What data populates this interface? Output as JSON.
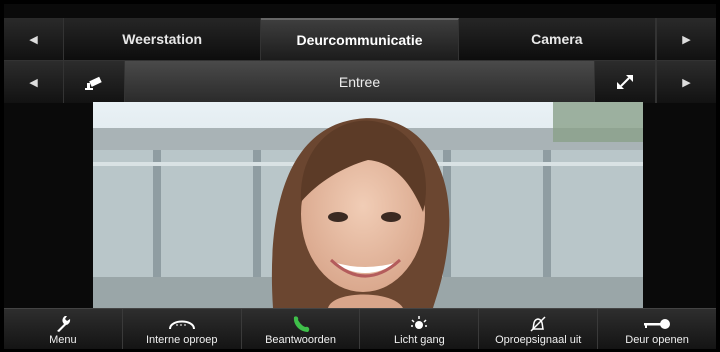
{
  "tabs": {
    "items": [
      {
        "label": "Weerstation"
      },
      {
        "label": "Deurcommunicatie"
      },
      {
        "label": "Camera"
      }
    ]
  },
  "camera": {
    "title": "Entree"
  },
  "actions": [
    {
      "label": "Menu",
      "icon": "wrench-icon"
    },
    {
      "label": "Interne oproep",
      "icon": "internal-call-icon"
    },
    {
      "label": "Beantwoorden",
      "icon": "answer-phone-icon"
    },
    {
      "label": "Licht gang",
      "icon": "light-icon"
    },
    {
      "label": "Oproepsignaal uit",
      "icon": "bell-mute-icon"
    },
    {
      "label": "Deur openen",
      "icon": "key-icon"
    }
  ],
  "colors": {
    "bar": "#1a1a1a",
    "active_tab": "#3a3a3a",
    "answer_green": "#3fbf4a"
  }
}
